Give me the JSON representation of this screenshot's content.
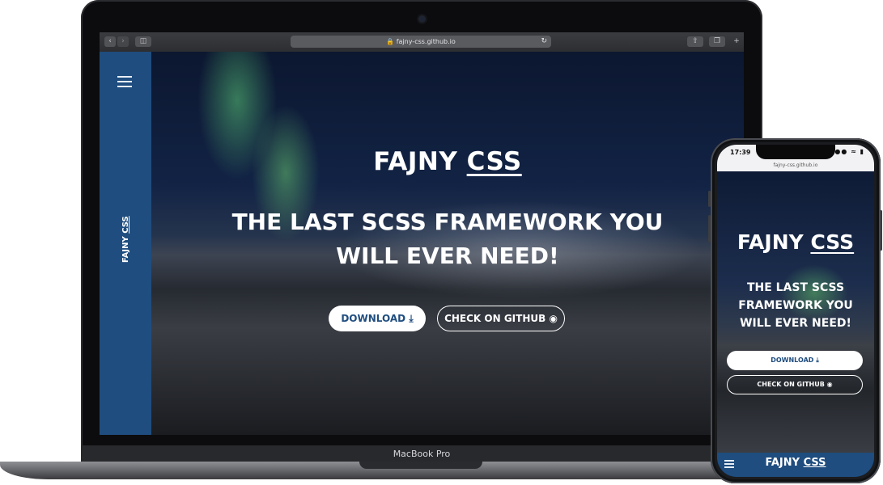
{
  "laptop": {
    "model_label": "MacBook Pro",
    "browser": {
      "url": "fajny-css.github.io",
      "reload_icon": "reload-icon",
      "back_icon": "chevron-left-icon",
      "forward_icon": "chevron-right-icon",
      "sidebar_icon": "sidebar-toggle-icon",
      "share_icon": "share-icon",
      "tabs_icon": "tabs-icon",
      "new_tab_icon": "plus-icon"
    },
    "site": {
      "sidebar_logo_part1": "FAJNY ",
      "sidebar_logo_part2": "CSS",
      "title_part1": "FAJNY ",
      "title_part2": "CSS",
      "subtitle_line1": "THE LAST SCSS FRAMEWORK YOU",
      "subtitle_line2": "WILL EVER NEED!",
      "download_label": "DOWNLOAD",
      "download_icon": "download-icon",
      "github_label": "CHECK ON GITHUB",
      "github_icon": "github-icon"
    }
  },
  "phone": {
    "status_time": "17:39",
    "status_icons": "signal-icon wifi-icon battery-icon",
    "url": "fajny-css.github.io",
    "site": {
      "title_part1": "FAJNY ",
      "title_part2": "CSS",
      "subtitle_line1": "THE LAST SCSS",
      "subtitle_line2": "FRAMEWORK YOU",
      "subtitle_line3": "WILL EVER NEED!",
      "download_label": "DOWNLOAD",
      "github_label": "CHECK ON GITHUB",
      "nav_logo_part1": "FAJNY ",
      "nav_logo_part2": "CSS"
    }
  },
  "colors": {
    "brand_blue": "#1f4d7f",
    "button_text": "#1f4d7f",
    "white": "#ffffff"
  }
}
